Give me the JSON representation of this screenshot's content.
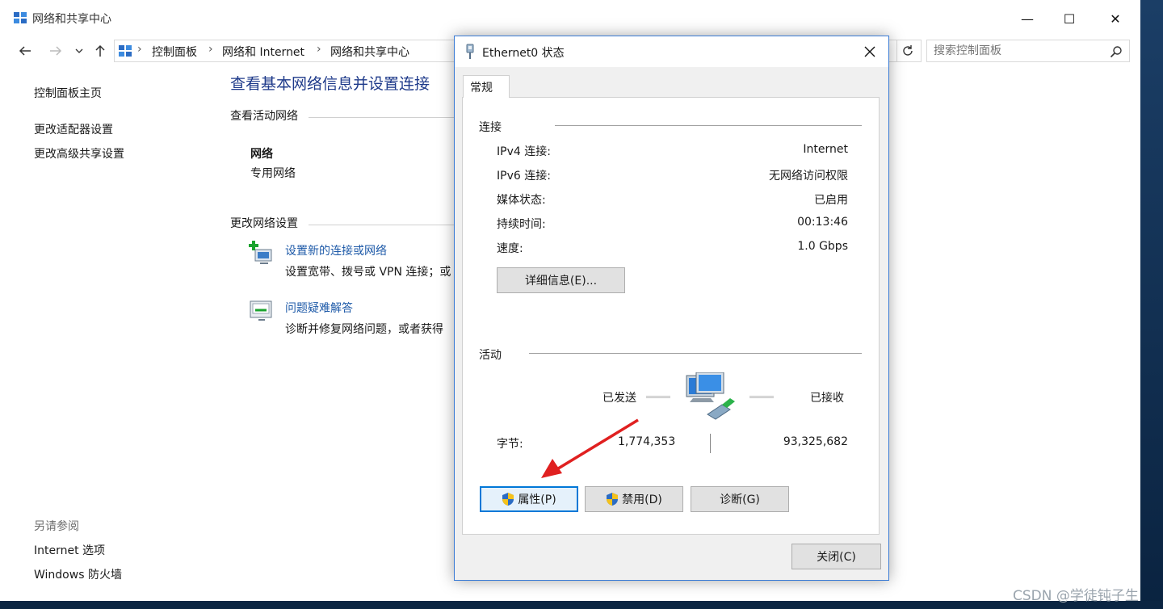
{
  "window": {
    "title": "网络和共享中心",
    "controls": {
      "minimize": "—",
      "maximize": "☐",
      "close": "✕"
    }
  },
  "address_bar": {
    "breadcrumbs": [
      "控制面板",
      "网络和 Internet",
      "网络和共享中心"
    ],
    "search_placeholder": "搜索控制面板"
  },
  "sidebar": {
    "links": [
      "控制面板主页",
      "更改适配器设置",
      "更改高级共享设置"
    ],
    "see_also_title": "另请参阅",
    "see_also": [
      "Internet 选项",
      "Windows 防火墙"
    ]
  },
  "main": {
    "title": "查看基本网络信息并设置连接",
    "active_networks_label": "查看活动网络",
    "network_name": "网络",
    "network_type": "专用网络",
    "change_settings_label": "更改网络设置",
    "tasks": [
      {
        "link": "设置新的连接或网络",
        "desc": "设置宽带、拨号或 VPN 连接；或"
      },
      {
        "link": "问题疑难解答",
        "desc": "诊断并修复网络问题，或者获得"
      }
    ]
  },
  "dialog": {
    "title": "Ethernet0 状态",
    "close_glyph": "✕",
    "tab": "常规",
    "connection_group": "连接",
    "rows": [
      {
        "label": "IPv4 连接:",
        "value": "Internet"
      },
      {
        "label": "IPv6 连接:",
        "value": "无网络访问权限"
      },
      {
        "label": "媒体状态:",
        "value": "已启用"
      },
      {
        "label": "持续时间:",
        "value": "00:13:46"
      },
      {
        "label": "速度:",
        "value": "1.0 Gbps"
      }
    ],
    "details_button": "详细信息(E)...",
    "activity_group": "活动",
    "sent_label": "已发送",
    "received_label": "已接收",
    "bytes_label": "字节:",
    "bytes_sent": "1,774,353",
    "bytes_received": "93,325,682",
    "buttons": {
      "properties": "属性(P)",
      "disable": "禁用(D)",
      "diagnose": "诊断(G)",
      "close": "关闭(C)"
    }
  },
  "annotation": {
    "arrow_color": "#e02020"
  },
  "watermark": "CSDN @学徒钝子生",
  "colors": {
    "link": "#1e5aa8",
    "title": "#1e3a8a",
    "focus": "#0078d7"
  }
}
